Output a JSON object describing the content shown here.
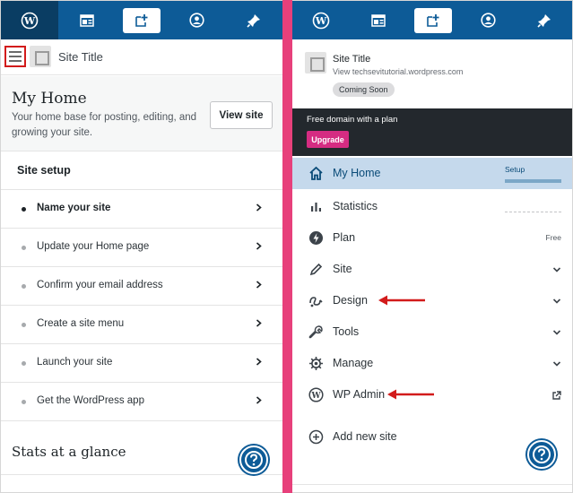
{
  "left": {
    "site_title": "Site Title",
    "my_home": {
      "heading": "My Home",
      "subtitle": "Your home base for posting, editing, and growing your site.",
      "view_site_label": "View site"
    },
    "setup_heading": "Site setup",
    "tasks": [
      {
        "label": "Name your site",
        "active": true
      },
      {
        "label": "Update your Home page",
        "active": false
      },
      {
        "label": "Confirm your email address",
        "active": false
      },
      {
        "label": "Create a site menu",
        "active": false
      },
      {
        "label": "Launch your site",
        "active": false
      },
      {
        "label": "Get the WordPress app",
        "active": false
      }
    ],
    "stats_heading": "Stats at a glance"
  },
  "right": {
    "site_title": "Site Title",
    "site_url": "View techsevitutorial.wordpress.com",
    "status_badge": "Coming Soon",
    "promo_text": "Free domain with a plan",
    "upgrade_label": "Upgrade",
    "menu": [
      {
        "label": "My Home",
        "icon": "home-icon",
        "badge": "Setup",
        "current": true
      },
      {
        "label": "Statistics",
        "icon": "stats-icon",
        "current": false
      },
      {
        "label": "Plan",
        "icon": "plan-icon",
        "badge": "Free",
        "current": false
      },
      {
        "label": "Site",
        "icon": "pencil-icon",
        "expandable": true,
        "current": false
      },
      {
        "label": "Design",
        "icon": "design-icon",
        "expandable": true,
        "current": false
      },
      {
        "label": "Tools",
        "icon": "wrench-icon",
        "expandable": true,
        "current": false
      },
      {
        "label": "Manage",
        "icon": "gear-icon",
        "expandable": true,
        "current": false
      },
      {
        "label": "WP Admin",
        "icon": "wordpress-icon",
        "external": true,
        "current": false
      },
      {
        "label": "Add new site",
        "icon": "add-circle-icon",
        "current": false
      }
    ]
  },
  "colors": {
    "topbar": "#0d5b97",
    "topbar_logo": "#0a3d63",
    "divider": "#e7407b",
    "upgrade": "#d52c82",
    "annotation_red": "#d21b1b",
    "menu_current": "#c5d9ec"
  },
  "topbar_icons": [
    "wordpress-icon",
    "reader-icon",
    "new-post-icon",
    "profile-icon",
    "notifications-icon"
  ]
}
